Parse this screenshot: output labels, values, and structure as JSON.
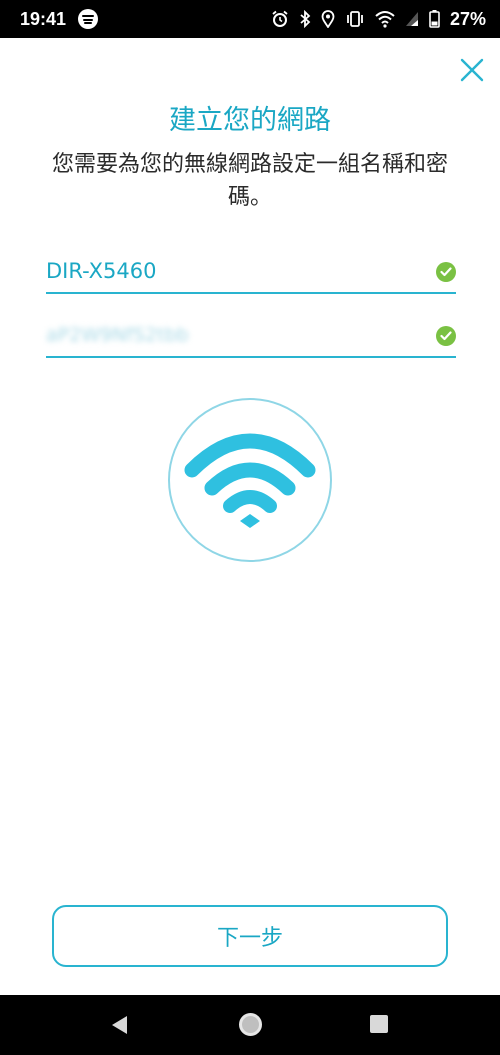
{
  "status_bar": {
    "time": "19:41",
    "battery_percent": "27%",
    "icons": [
      "spotify-icon",
      "alarm-icon",
      "bluetooth-icon",
      "location-icon",
      "vibrate-icon",
      "wifi-icon",
      "signal-icon",
      "battery-icon"
    ]
  },
  "header": {
    "title": "建立您的網路",
    "subtitle": "您需要為您的無線網路設定一組名稱和密碼。"
  },
  "form": {
    "network_name": {
      "value": "DIR-X5460",
      "valid": true
    },
    "password": {
      "value": "aP2W9NfS2tbb",
      "valid": true,
      "blurred": true
    }
  },
  "illustration": {
    "icon": "wifi-icon"
  },
  "actions": {
    "next_label": "下一步"
  },
  "colors": {
    "accent": "#1aa7c4",
    "underline": "#29b4d0",
    "check": "#7ac143",
    "text": "#2b2b2b"
  },
  "nav_bar": {
    "icons": [
      "back-icon",
      "home-icon",
      "recents-icon"
    ]
  }
}
